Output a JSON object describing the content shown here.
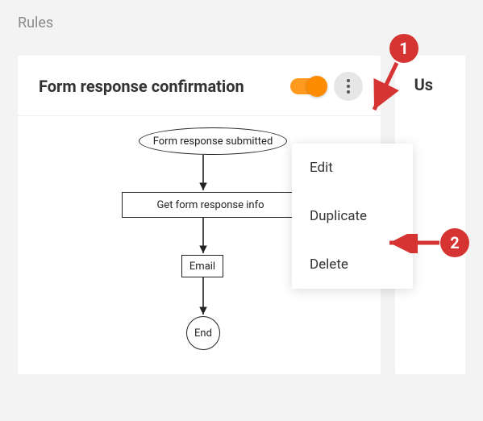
{
  "page": {
    "title": "Rules"
  },
  "card": {
    "title": "Form response confirmation",
    "toggle_on": true
  },
  "secondary_card": {
    "title_fragment": "Us"
  },
  "flow": {
    "nodes": {
      "start": "Form response submitted",
      "step1": "Get form response info",
      "step2": "Email",
      "end": "End"
    }
  },
  "menu": {
    "edit": "Edit",
    "duplicate": "Duplicate",
    "delete": "Delete"
  },
  "annotations": {
    "badge1": "1",
    "badge2": "2",
    "color": "#d63333"
  }
}
